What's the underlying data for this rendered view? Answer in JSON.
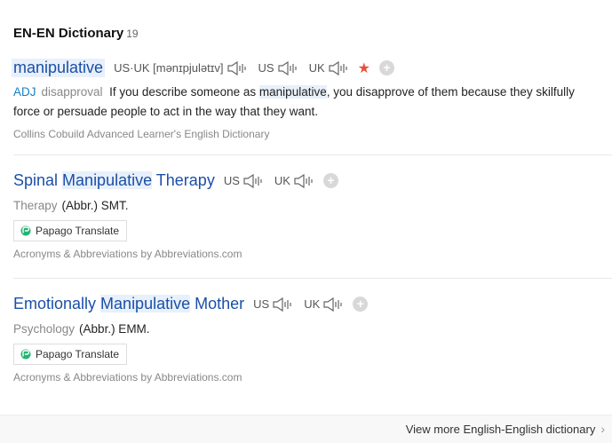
{
  "header": {
    "title": "EN-EN Dictionary",
    "count": "19"
  },
  "entries": [
    {
      "word": "manipulative",
      "pron_label": "US·UK",
      "ipa": "[mənɪpjulətɪv]",
      "us": "US",
      "uk": "UK",
      "pos": "ADJ",
      "gram": "disapproval",
      "def_before": "If you describe someone as ",
      "def_hl": "manipulative",
      "def_after": ", you disapprove of them because they skilfully force or persuade people to act in the way that they want.",
      "source": "Collins Cobuild Advanced Learner's English Dictionary"
    },
    {
      "word_pre": "Spinal ",
      "word_hl": "Manipulative",
      "word_post": " Therapy",
      "us": "US",
      "uk": "UK",
      "category": "Therapy",
      "abbr": "(Abbr.) SMT.",
      "papago": "Papago Translate",
      "source": "Acronyms & Abbreviations by Abbreviations.com"
    },
    {
      "word_pre": "Emotionally ",
      "word_hl": "Manipulative",
      "word_post": " Mother",
      "us": "US",
      "uk": "UK",
      "category": "Psychology",
      "abbr": "(Abbr.) EMM.",
      "papago": "Papago Translate",
      "source": "Acronyms & Abbreviations by Abbreviations.com"
    }
  ],
  "footer": {
    "more": "View more English-English dictionary"
  },
  "colors": {
    "link": "#1a4fa8",
    "highlight": "#e8f0fa",
    "star": "#e6503c",
    "pos": "#1a7fc1"
  }
}
